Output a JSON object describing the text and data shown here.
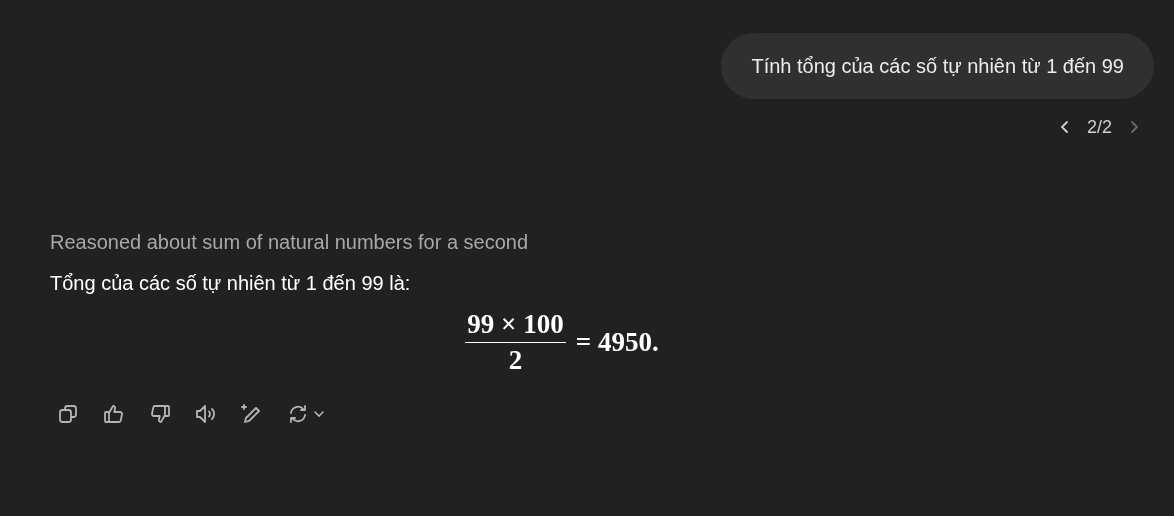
{
  "user_message": {
    "text": "Tính tổng của các số tự nhiên từ 1 đến 99"
  },
  "pager": {
    "prev": {
      "disabled": false
    },
    "label": "2/2",
    "next": {
      "disabled": true
    }
  },
  "reasoning": {
    "text": "Reasoned about sum of natural numbers for a second"
  },
  "answer": {
    "text": "Tổng của các số tự nhiên từ 1 đến 99 là:",
    "formula": {
      "numerator": "99 × 100",
      "denominator": "2",
      "result": "= 4950."
    }
  },
  "actions": [
    {
      "kind": "copy"
    },
    {
      "kind": "thumbs-up"
    },
    {
      "kind": "thumbs-down"
    },
    {
      "kind": "speaker"
    },
    {
      "kind": "edit"
    },
    {
      "kind": "regenerate"
    }
  ]
}
